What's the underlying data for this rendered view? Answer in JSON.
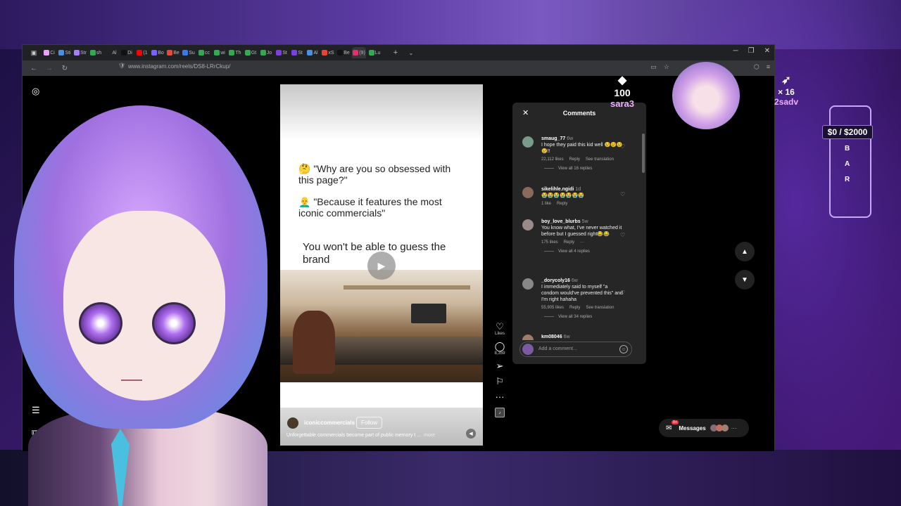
{
  "browser": {
    "tabs": [
      {
        "label": "Ci",
        "color": "#e9a1ff"
      },
      {
        "label": "Sti",
        "color": "#4a90e2"
      },
      {
        "label": "Str",
        "color": "#a87cff"
      },
      {
        "label": "sh",
        "color": "#34a853"
      },
      {
        "label": "Al",
        "color": "#222"
      },
      {
        "label": "Di",
        "color": "#111"
      },
      {
        "label": "(1",
        "color": "#ff0000"
      },
      {
        "label": "Bo",
        "color": "#7b61ff"
      },
      {
        "label": "Be",
        "color": "#e34a3a"
      },
      {
        "label": "Su",
        "color": "#3a7ae3"
      },
      {
        "label": "cc",
        "color": "#34a853"
      },
      {
        "label": "wi",
        "color": "#34a853"
      },
      {
        "label": "Th",
        "color": "#34a853"
      },
      {
        "label": "Gt",
        "color": "#34a853"
      },
      {
        "label": "Jo",
        "color": "#34a853"
      },
      {
        "label": "St",
        "color": "#7b3fe4"
      },
      {
        "label": "St",
        "color": "#7b3fe4"
      },
      {
        "label": "Al",
        "color": "#4a90e2"
      },
      {
        "label": "xS",
        "color": "#ea4335"
      },
      {
        "label": "Be",
        "color": "#111"
      },
      {
        "label": "(9)",
        "color": "#e1306c"
      },
      {
        "label": "Lu",
        "color": "#34a853"
      }
    ],
    "active_tab_index": 20,
    "url": "www.instagram.com/reels/DS8-LRrCkup/"
  },
  "reel": {
    "question_emoji": "🤔",
    "question": "\"Why are you so obsessed with this page?\"",
    "answer_emoji": "👨‍🦲",
    "answer": "\"Because it features the most iconic commercials\"",
    "hint": "You won't be able to guess the brand",
    "username": "iconiccommercials",
    "follow_label": "Follow",
    "caption": "Unforgettable commercials become part of public memory t ...",
    "more_label": "more"
  },
  "actions": {
    "likes_label": "Likes",
    "comments_count": "8,359"
  },
  "comments_panel": {
    "title": "Comments",
    "input_placeholder": "Add a comment...",
    "comments": [
      {
        "user": "smaug_77",
        "time": "6w",
        "text": "I hope they paid this kid well 😢😢😢😢‼",
        "likes": "22,112 likes",
        "reply": "Reply",
        "translation": "See translation",
        "replies": "View all 16 replies"
      },
      {
        "user": "sikelihle.ngidi",
        "time": "1d",
        "text": "😭😭😭😭😭😭😭",
        "likes": "1 like",
        "reply": "Reply",
        "translation": "",
        "replies": ""
      },
      {
        "user": "boy_love_blurbs",
        "time": "5w",
        "text": "You know what, I've never watched it before but I guessed right😂😂",
        "likes": "175 likes",
        "reply": "Reply",
        "translation": "",
        "replies": "View all 4 replies"
      },
      {
        "user": "_dorycoly16",
        "time": "6w",
        "text": "I immediately said to myself \"a condom would've prevented this\" and I'm right hahaha",
        "likes": "55,905 likes",
        "reply": "Reply",
        "translation": "See translation",
        "replies": "View all 34 replies"
      },
      {
        "user": "km08046",
        "time": "6w",
        "text": "",
        "likes": "",
        "reply": "",
        "translation": "",
        "replies": ""
      }
    ]
  },
  "messages": {
    "label": "Messages",
    "badge": "9+"
  },
  "stream_overlay": {
    "left_stat_value": "100",
    "left_stat_name": "sara3",
    "right_stat_value": "× 16",
    "right_stat_name": "2sadv",
    "goal": "$0 / $2000",
    "goal_letters": [
      "B",
      "A",
      "R"
    ]
  }
}
